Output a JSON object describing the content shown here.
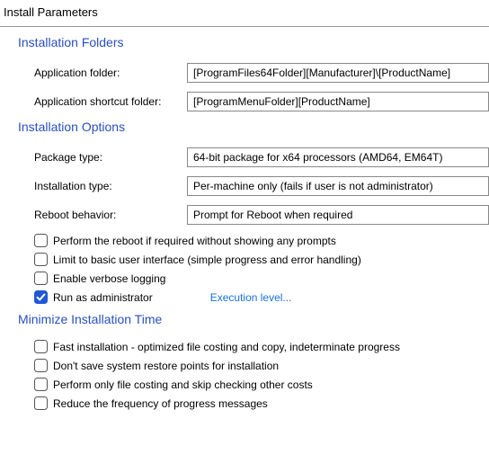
{
  "page_title": "Install Parameters",
  "sections": {
    "folders": {
      "legend": "Installation Folders",
      "app_folder_label": "Application folder:",
      "app_folder_value": "[ProgramFiles64Folder][Manufacturer]\\[ProductName]",
      "shortcut_folder_label": "Application shortcut folder:",
      "shortcut_folder_value": "[ProgramMenuFolder][ProductName]"
    },
    "options": {
      "legend": "Installation Options",
      "package_type_label": "Package type:",
      "package_type_value": "64-bit package for x64 processors (AMD64, EM64T)",
      "install_type_label": "Installation type:",
      "install_type_value": "Per-machine only (fails if user is not administrator)",
      "reboot_label": "Reboot behavior:",
      "reboot_value": "Prompt for Reboot when required",
      "cb_silent_reboot": "Perform the reboot if required without showing any prompts",
      "cb_basic_ui": "Limit to basic user interface (simple progress and error handling)",
      "cb_verbose": "Enable verbose logging",
      "cb_run_admin": "Run as administrator",
      "execution_level_link": "Execution level..."
    },
    "minimize": {
      "legend": "Minimize Installation Time",
      "cb_fast_install": "Fast installation - optimized file costing and copy, indeterminate progress",
      "cb_no_restore": "Don't save system restore points for installation",
      "cb_file_costing": "Perform only file costing and skip checking other costs",
      "cb_reduce_progress": "Reduce the frequency of progress messages"
    }
  },
  "checkbox_states": {
    "silent_reboot": false,
    "basic_ui": false,
    "verbose": false,
    "run_admin": true,
    "fast_install": false,
    "no_restore": false,
    "file_costing": false,
    "reduce_progress": false
  }
}
